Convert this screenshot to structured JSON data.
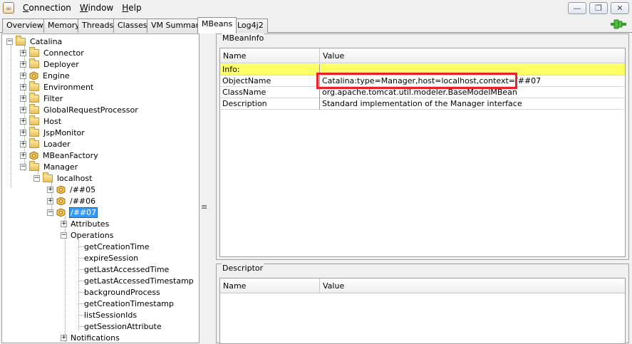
{
  "menu": {
    "items": [
      "Connection",
      "Window",
      "Help"
    ]
  },
  "window_controls": {
    "minimize": "—",
    "restore": "❐",
    "close": "✕"
  },
  "tabs": [
    "Overview",
    "Memory",
    "Threads",
    "Classes",
    "VM Summary",
    "MBeans",
    "Log4j2"
  ],
  "active_tab": "MBeans",
  "tree": {
    "root": "Catalina",
    "nodes": [
      {
        "label": "Connector",
        "icon": "folder"
      },
      {
        "label": "Deployer",
        "icon": "folder"
      },
      {
        "label": "Engine",
        "icon": "bean"
      },
      {
        "label": "Environment",
        "icon": "folder"
      },
      {
        "label": "Filter",
        "icon": "folder"
      },
      {
        "label": "GlobalRequestProcessor",
        "icon": "folder"
      },
      {
        "label": "Host",
        "icon": "folder"
      },
      {
        "label": "JspMonitor",
        "icon": "folder"
      },
      {
        "label": "Loader",
        "icon": "folder"
      },
      {
        "label": "MBeanFactory",
        "icon": "bean"
      },
      {
        "label": "Manager",
        "icon": "folder"
      }
    ],
    "manager_child": "localhost",
    "contexts": [
      "/##05",
      "/##06",
      "/##07"
    ],
    "selected_context": "/##07",
    "bean_sections": [
      "Attributes",
      "Operations",
      "Notifications"
    ],
    "operations": [
      "getCreationTime",
      "expireSession",
      "getLastAccessedTime",
      "getLastAccessedTimestamp",
      "backgroundProcess",
      "getCreationTimestamp",
      "listSessionIds",
      "getSessionAttribute"
    ]
  },
  "mbeaninfo": {
    "title": "MBeanInfo",
    "col_name": "Name",
    "col_value": "Value",
    "rows": [
      {
        "name": "Info:",
        "value": ""
      },
      {
        "name": "ObjectName",
        "value": "Catalina:type=Manager,host=localhost,context=/##07"
      },
      {
        "name": "ClassName",
        "value": "org.apache.tomcat.util.modeler.BaseModelMBean"
      },
      {
        "name": "Description",
        "value": "Standard implementation of the Manager interface"
      }
    ]
  },
  "descriptor": {
    "title": "Descriptor",
    "col_name": "Name",
    "col_value": "Value"
  },
  "colors": {
    "info_row": "#ffff66",
    "highlight": "#e8212a",
    "selection": "#3399ff"
  }
}
